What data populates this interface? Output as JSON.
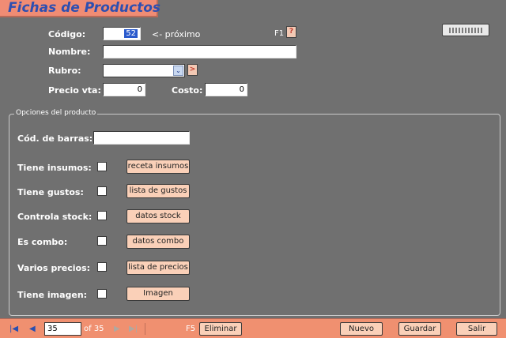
{
  "header": {
    "title": "Fichas de Productos"
  },
  "form": {
    "codigo": {
      "label": "Código:",
      "value": "52",
      "hint": "<- próximo"
    },
    "help": {
      "key_label": "F1",
      "button": "?"
    },
    "nombre": {
      "label": "Nombre:",
      "value": ""
    },
    "rubro": {
      "label": "Rubro:",
      "value": "",
      "arrow": "⌄",
      "go": ">"
    },
    "precio_vta": {
      "label": "Precio vta:",
      "value": "0"
    },
    "costo": {
      "label": "Costo:",
      "value": "0"
    }
  },
  "options": {
    "group_title": "Opciones del producto",
    "barcode": {
      "label": "Cód. de barras:",
      "value": ""
    },
    "rows": [
      {
        "label": "Tiene insumos:",
        "checked": false,
        "button": "receta insumos"
      },
      {
        "label": "Tiene gustos:",
        "checked": false,
        "button": "lista de gustos"
      },
      {
        "label": "Controla stock:",
        "checked": false,
        "button": "datos stock"
      },
      {
        "label": "Es combo:",
        "checked": false,
        "button": "datos combo"
      },
      {
        "label": "Varios precios:",
        "checked": false,
        "button": "lista de precios"
      },
      {
        "label": "Tiene imagen:",
        "checked": false,
        "button": "Imagen"
      }
    ]
  },
  "navigator": {
    "first": "|◀",
    "prev": "◀",
    "record": "35",
    "of_label": "of 35",
    "next": "▶",
    "last": "▶|"
  },
  "toolbar": {
    "delete_key": "F5",
    "delete": "Eliminar",
    "new": "Nuevo",
    "save": "Guardar",
    "exit": "Salir"
  },
  "icons": {
    "keyboard": "keyboard-icon"
  },
  "colors": {
    "accent": "#f08c74",
    "title": "#2e4fb0",
    "background": "#707070",
    "button": "#fad0b8"
  }
}
